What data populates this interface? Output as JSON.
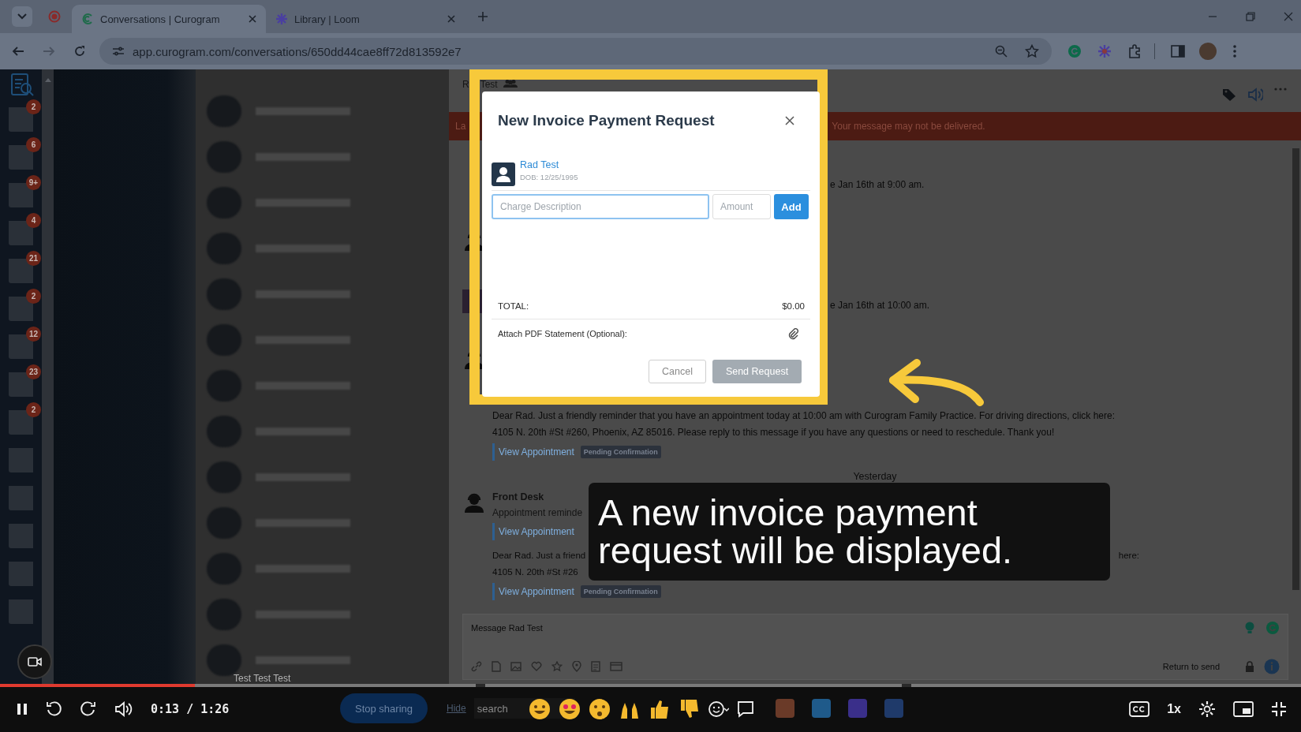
{
  "browser": {
    "tabs": [
      {
        "title": "Conversations | Curogram",
        "selected": true
      },
      {
        "title": "Library | Loom",
        "selected": false
      }
    ],
    "url": "app.curogram.com/conversations/650dd44cae8ff72d813592e7"
  },
  "rail": {
    "apps": [
      {
        "kind": "badged",
        "badge": "2"
      },
      {
        "kind": "badged",
        "badge": "6"
      },
      {
        "kind": "badged",
        "badge": "9+"
      },
      {
        "kind": "badged",
        "badge": "4"
      },
      {
        "kind": "badged",
        "badge": "21"
      },
      {
        "kind": "badged",
        "badge": "2"
      },
      {
        "kind": "badged",
        "badge": "12"
      },
      {
        "kind": "badged",
        "badge": "23"
      },
      {
        "kind": "badged",
        "badge": "2"
      },
      {
        "kind": "plain"
      },
      {
        "kind": "plain"
      },
      {
        "kind": "plain"
      },
      {
        "kind": "plain"
      },
      {
        "kind": "plain"
      }
    ]
  },
  "conversation_list": {
    "last_item": "Test Test Test"
  },
  "chat": {
    "header": {
      "name_start": "R",
      "name_end": "Test"
    },
    "banner": {
      "text_start": "La",
      "text_end": "Your message may not be delivered."
    },
    "messages": [
      {
        "kind": "partial",
        "text": "e Jan 16th at 9:00 am."
      },
      {
        "kind": "agent"
      },
      {
        "kind": "photo_partial",
        "text": "e Jan 16th at 10:00 am."
      },
      {
        "kind": "agent"
      },
      {
        "kind": "full",
        "lines": [
          "Dear Rad. Just a friendly reminder that you have an appointment today at 10:00 am with Curogram Family Practice. For driving directions, click here:",
          "4105 N. 20th #St #260, Phoenix, AZ 85016. Please reply to this message if you have any questions or need to reschedule. Thank you!"
        ],
        "link": "View Appointment",
        "status": "Pending Confirmation"
      },
      {
        "kind": "divider",
        "text": "Yesterday"
      },
      {
        "kind": "sender",
        "sender": "Front Desk",
        "preview": "Appointment reminde",
        "link": "View Appointment"
      },
      {
        "kind": "covered",
        "lines": [
          {
            "left": "Dear Rad. Just a friend",
            "right": "here:"
          },
          {
            "left": "4105 N. 20th #St #26"
          }
        ],
        "link": "View Appointment",
        "status": "Pending Confirmation"
      }
    ],
    "composer": {
      "placeholder": "Message Rad Test",
      "send_hint": "Return to send"
    }
  },
  "modal": {
    "title": "New Invoice Payment Request",
    "patient": {
      "name": "Rad Test",
      "dob": "DOB: 12/25/1995"
    },
    "charge_field": {
      "placeholder": "Charge Description",
      "focused": true
    },
    "amount_field": {
      "placeholder": "Amount",
      "focused": false
    },
    "add_label": "Add",
    "total_label": "TOTAL:",
    "total_value": "$0.00",
    "attach_label": "Attach PDF Statement (Optional):",
    "buttons": [
      {
        "label": "Cancel",
        "kind": "secondary",
        "disabled": false
      },
      {
        "label": "Send Request",
        "kind": "primary",
        "disabled": true
      }
    ]
  },
  "caption": "A new invoice payment request will be displayed.",
  "screen_share": {
    "button": "Stop sharing",
    "link": "Hide",
    "search_placeholder": "search"
  },
  "player": {
    "level": 0.15,
    "time": "0:13 / 1:26",
    "speed": "1x"
  }
}
